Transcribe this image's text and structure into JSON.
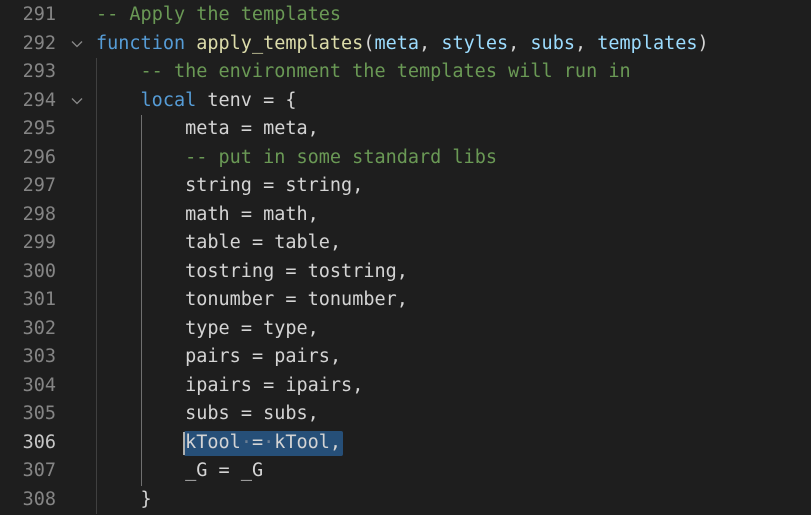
{
  "editor": {
    "language": "lua",
    "current_line": "306",
    "lines": [
      {
        "num": "291",
        "code": "-- Apply the templates"
      },
      {
        "num": "292",
        "code": "function apply_templates(meta, styles, subs, templates)",
        "foldable": true
      },
      {
        "num": "293",
        "code": "    -- the environment the templates will run in"
      },
      {
        "num": "294",
        "code": "    local tenv = {",
        "foldable": true
      },
      {
        "num": "295",
        "code": "        meta = meta,"
      },
      {
        "num": "296",
        "code": "        -- put in some standard libs"
      },
      {
        "num": "297",
        "code": "        string = string,"
      },
      {
        "num": "298",
        "code": "        math = math,"
      },
      {
        "num": "299",
        "code": "        table = table,"
      },
      {
        "num": "300",
        "code": "        tostring = tostring,"
      },
      {
        "num": "301",
        "code": "        tonumber = tonumber,"
      },
      {
        "num": "302",
        "code": "        type = type,"
      },
      {
        "num": "303",
        "code": "        pairs = pairs,"
      },
      {
        "num": "304",
        "code": "        ipairs = ipairs,"
      },
      {
        "num": "305",
        "code": "        subs = subs,"
      },
      {
        "num": "306",
        "code": "        kTool = kTool,",
        "selected": true
      },
      {
        "num": "307",
        "code": "        _G = _G"
      },
      {
        "num": "308",
        "code": "    }"
      }
    ],
    "colors": {
      "background": "#1e1e1e",
      "line_number": "#858585",
      "current_line_number": "#c6c6c6",
      "keyword": "#569cd6",
      "function": "#dcdcaa",
      "parameter": "#9cdcfe",
      "comment": "#6a9955",
      "text": "#d4d4d4",
      "selection": "#264f78"
    },
    "icons": {
      "fold": "chevron-down-icon"
    }
  }
}
